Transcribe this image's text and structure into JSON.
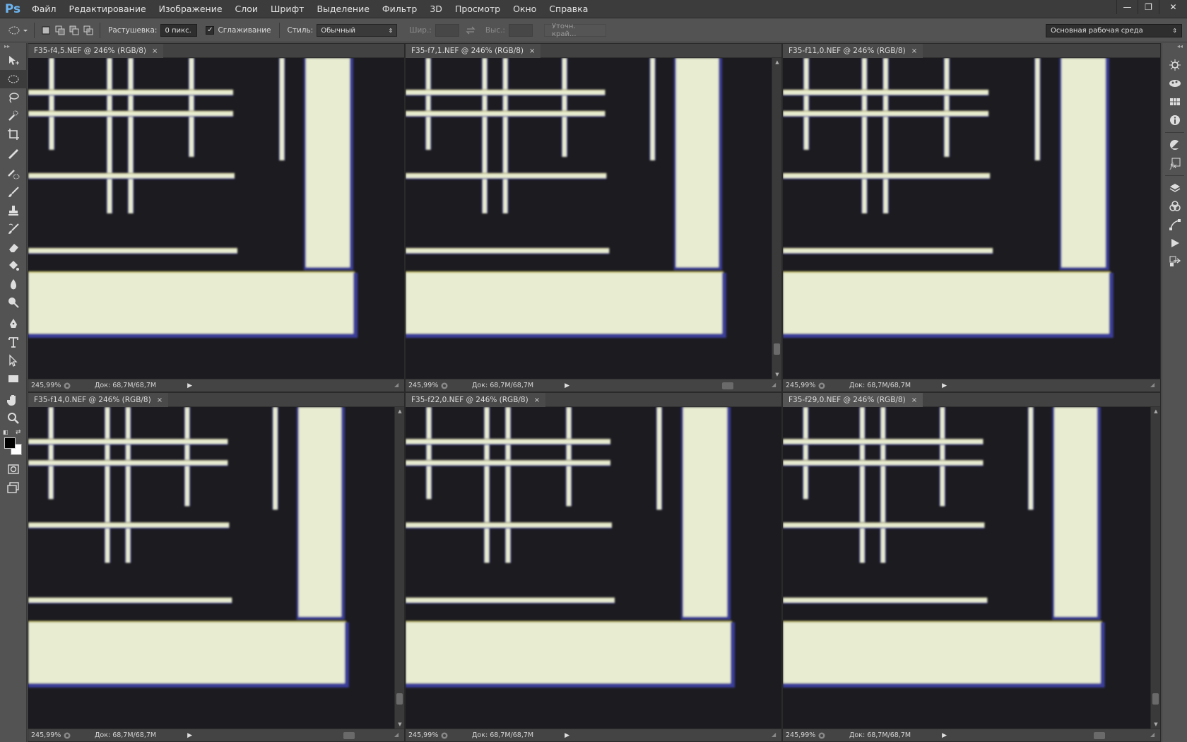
{
  "app": {
    "logo": "Ps",
    "menu": [
      "Файл",
      "Редактирование",
      "Изображение",
      "Слои",
      "Шрифт",
      "Выделение",
      "Фильтр",
      "3D",
      "Просмотр",
      "Окно",
      "Справка"
    ],
    "window_controls": {
      "minimize": "—",
      "restore": "❐",
      "close": "✕"
    }
  },
  "options": {
    "feather_label": "Растушевка:",
    "feather_value": "0 пикс.",
    "antialias_label": "Сглаживание",
    "antialias_checked": "✓",
    "style_label": "Стиль:",
    "style_value": "Обычный",
    "width_label": "Шир.:",
    "height_label": "Выс.:",
    "refine_edge": "Уточн. край...",
    "workspace": "Основная рабочая среда"
  },
  "documents": [
    {
      "title": "F35-f4,5.NEF @ 246% (RGB/8)",
      "zoom": "245,99%",
      "doc_info": "Док: 68,7M/68,7M",
      "close": "×"
    },
    {
      "title": "F35-f7,1.NEF @ 246% (RGB/8)",
      "zoom": "245,99%",
      "doc_info": "Док: 68,7M/68,7M",
      "close": "×"
    },
    {
      "title": "F35-f11,0.NEF @ 246% (RGB/8)",
      "zoom": "245,99%",
      "doc_info": "Док: 68,7M/68,7M",
      "close": "×"
    },
    {
      "title": "F35-f14,0.NEF @ 246% (RGB/8)",
      "zoom": "245,99%",
      "doc_info": "Док: 68,7M/68,7M",
      "close": "×"
    },
    {
      "title": "F35-f22,0.NEF @ 246% (RGB/8)",
      "zoom": "245,99%",
      "doc_info": "Док: 68,7M/68,7M",
      "close": "×"
    },
    {
      "title": "F35-f29,0.NEF @ 246% (RGB/8)",
      "zoom": "245,99%",
      "doc_info": "Док: 68,7M/68,7M",
      "close": "×"
    }
  ],
  "colors": {
    "foreground": "#000000",
    "background": "#ffffff",
    "line_color": "#e8ecd0",
    "canvas_bg": "#1c1b20",
    "fringe_blue": "#3a3c9a",
    "fringe_yellow": "#c9c460"
  }
}
